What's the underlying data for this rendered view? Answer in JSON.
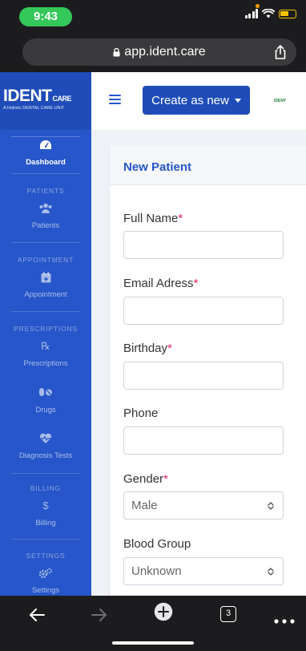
{
  "status_bar": {
    "time": "9:43"
  },
  "browser": {
    "url": "app.ident.care",
    "tab_count": "3"
  },
  "brand": {
    "name": "IDENT",
    "suffix": "CARE",
    "tagline": "A Holistic DENTAL CARE UNIT",
    "mini_logo": "IDENT"
  },
  "sidebar": {
    "dashboard": "Dashboard",
    "sections": {
      "patients": "PATIENTS",
      "appointment": "APPOINTMENT",
      "prescriptions": "PRESCRIPTIONS",
      "billing": "BILLING",
      "settings": "SETTINGS"
    },
    "items": {
      "patients": "Patients",
      "appointment": "Appointment",
      "prescriptions": "Prescriptions",
      "prescriptions_glyph": "℞",
      "drugs": "Drugs",
      "diagnosis": "Diagnosis Tests",
      "billing": "Billing",
      "billing_glyph": "$",
      "settings": "Settings"
    }
  },
  "topbar": {
    "create_label": "Create as new"
  },
  "form": {
    "title": "New Patient",
    "required_mark": "*",
    "full_name": "Full Name",
    "email": "Email Adress",
    "birthday": "Birthday",
    "phone": "Phone",
    "gender": "Gender",
    "gender_value": "Male",
    "blood_group": "Blood Group",
    "blood_group_value": "Unknown"
  },
  "colors": {
    "sidebar": "#2656c9",
    "accent": "#1f4cb8",
    "required": "#e0245e"
  }
}
